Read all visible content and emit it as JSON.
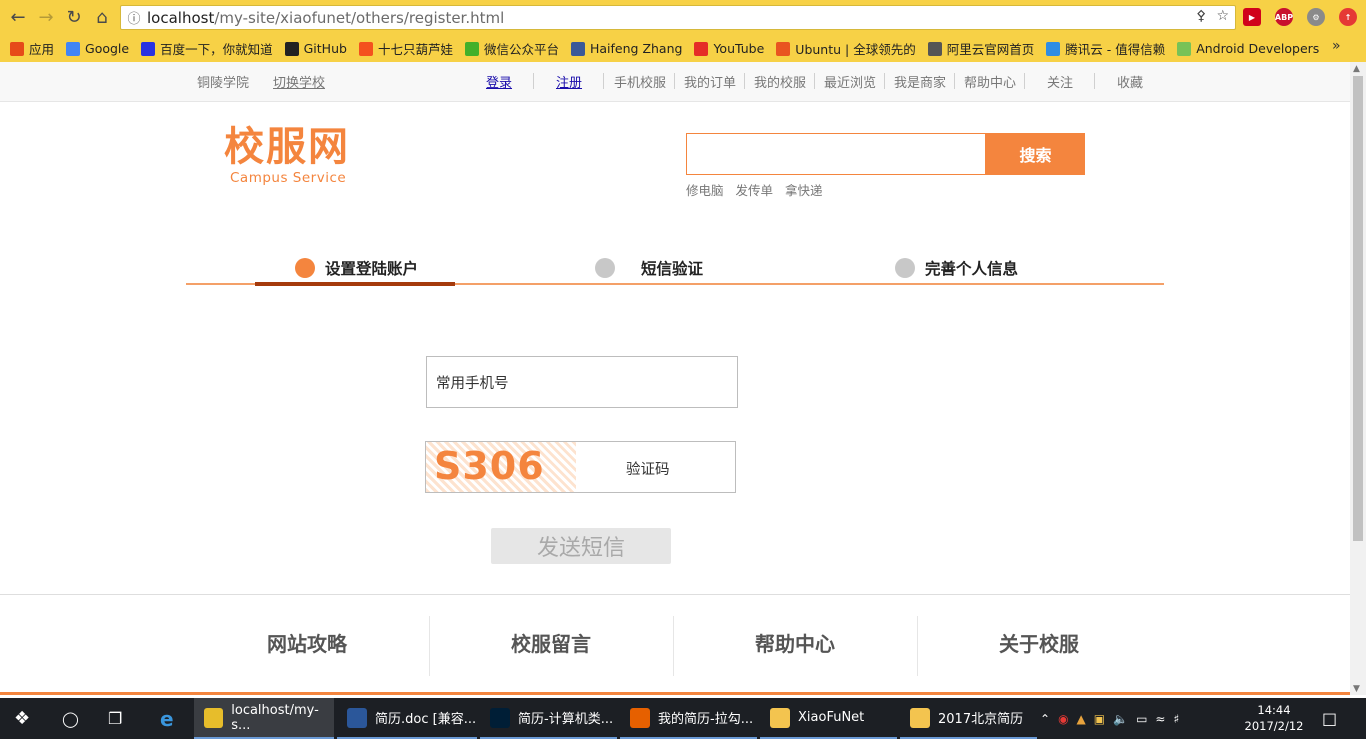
{
  "browser": {
    "url_host": "localhost",
    "url_path": "/my-site/xiaofunet/others/register.html"
  },
  "bookmarks": [
    {
      "label": "应用",
      "icon": "apps-grid-icon",
      "color": "#e64a19"
    },
    {
      "label": "Google",
      "icon": "google-icon",
      "color": "#4285f4"
    },
    {
      "label": "百度一下，你就知道",
      "icon": "baidu-paw-icon",
      "color": "#2932e1"
    },
    {
      "label": "GitHub",
      "icon": "github-icon",
      "color": "#222222"
    },
    {
      "label": "十七只葫芦娃",
      "icon": "gourd-icon",
      "color": "#f4511e"
    },
    {
      "label": "微信公众平台",
      "icon": "wechat-icon",
      "color": "#43b02a"
    },
    {
      "label": "Haifeng Zhang",
      "icon": "facebook-icon",
      "color": "#3b5998"
    },
    {
      "label": "YouTube",
      "icon": "youtube-icon",
      "color": "#e52d27"
    },
    {
      "label": "Ubuntu | 全球领先的",
      "icon": "ubuntu-icon",
      "color": "#e95420"
    },
    {
      "label": "阿里云官网首页",
      "icon": "aliyun-icon",
      "color": "#555555"
    },
    {
      "label": "腾讯云 - 值得信赖",
      "icon": "tencent-cloud-icon",
      "color": "#2f8de4"
    },
    {
      "label": "Android Developers",
      "icon": "android-icon",
      "color": "#78c257"
    }
  ],
  "topbar": {
    "school": "铜陵学院",
    "switch_school": "切换学校",
    "login": "登录",
    "register": "注册",
    "links": [
      "手机校服",
      "我的订单",
      "我的校服",
      "最近浏览",
      "我是商家",
      "帮助中心",
      "关注",
      "收藏"
    ]
  },
  "logo": {
    "cn": "校服网",
    "en": "Campus Service"
  },
  "search": {
    "button": "搜索",
    "hot": [
      "修电脑",
      "发传单",
      "拿快递"
    ]
  },
  "steps": [
    {
      "label": "设置登陆账户",
      "color": "#f4853e"
    },
    {
      "label": "短信验证",
      "color": "#c8c8c8"
    },
    {
      "label": "完善个人信息",
      "color": "#c8c8c8"
    }
  ],
  "form": {
    "phone_placeholder": "常用手机号",
    "captcha_text": "S306",
    "captcha_placeholder": "验证码",
    "send_button": "发送短信"
  },
  "footer": [
    "网站攻略",
    "校服留言",
    "帮助中心",
    "关于校服"
  ],
  "taskbar": {
    "items": [
      {
        "label": "localhost/my-s...",
        "icon": "chrome-icon",
        "color": "#e7bd2b"
      },
      {
        "label": "简历.doc [兼容...",
        "icon": "word-icon",
        "color": "#2b579a"
      },
      {
        "label": "简历-计算机类...",
        "icon": "photoshop-icon",
        "color": "#001e36"
      },
      {
        "label": "我的简历-拉勾...",
        "icon": "firefox-icon",
        "color": "#e66000"
      },
      {
        "label": "XiaoFuNet",
        "icon": "folder-icon",
        "color": "#f3c44f"
      },
      {
        "label": "2017北京简历",
        "icon": "folder-icon",
        "color": "#f3c44f"
      }
    ],
    "time": "14:44",
    "date": "2017/2/12"
  }
}
